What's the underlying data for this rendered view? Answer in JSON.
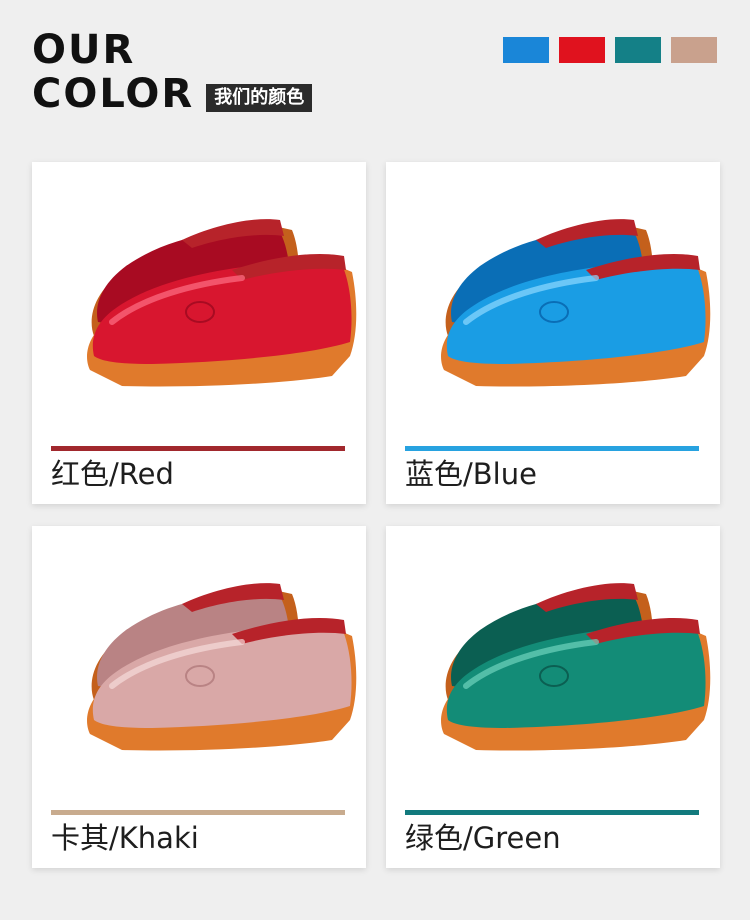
{
  "header": {
    "title_line1": "OUR",
    "title_line2": "COLOR",
    "badge": "我们的颜色"
  },
  "swatches": [
    {
      "name": "blue",
      "color": "#1a86d8"
    },
    {
      "name": "red",
      "color": "#e0121e"
    },
    {
      "name": "teal",
      "color": "#148087"
    },
    {
      "name": "khaki",
      "color": "#c9a18d"
    }
  ],
  "cards": [
    {
      "label": "红色/Red",
      "bar_color": "#a1282d",
      "shoe_color": "#d8162f",
      "shoe_shadow": "#a80b22",
      "highlight": "#ff6f84"
    },
    {
      "label": "蓝色/Blue",
      "bar_color": "#27a2e0",
      "shoe_color": "#1a9de4",
      "shoe_shadow": "#0a6eb6",
      "highlight": "#8fd9ff"
    },
    {
      "label": "卡其/Khaki",
      "bar_color": "#c8ab8e",
      "shoe_color": "#d9a8a7",
      "shoe_shadow": "#b98384",
      "highlight": "#f5dbda"
    },
    {
      "label": "绿色/Green",
      "bar_color": "#127a7d",
      "shoe_color": "#138c77",
      "shoe_shadow": "#0b5f52",
      "highlight": "#6fd3bd"
    }
  ]
}
